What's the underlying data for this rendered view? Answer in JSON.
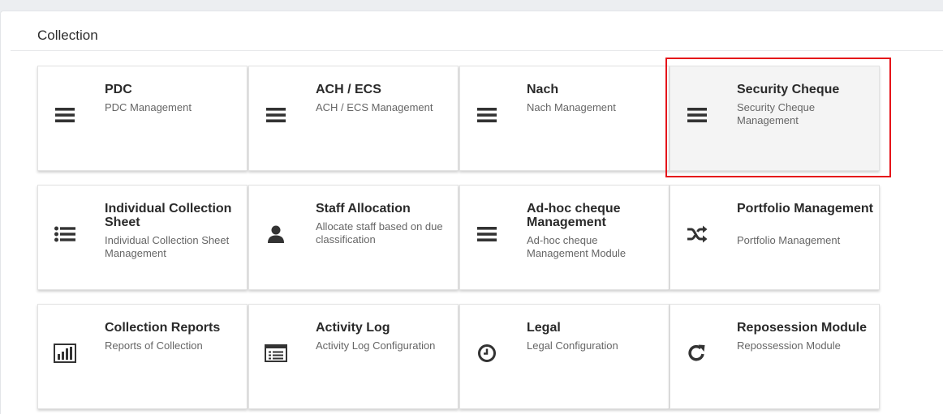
{
  "page": {
    "title": "Collection"
  },
  "cards": [
    {
      "title": "PDC",
      "description": "PDC Management",
      "icon": "bars-icon"
    },
    {
      "title": "ACH / ECS",
      "description": "ACH / ECS Management",
      "icon": "bars-icon"
    },
    {
      "title": "Nach",
      "description": "Nach Management",
      "icon": "bars-icon"
    },
    {
      "title": "Security Cheque",
      "description": "Security Cheque Management",
      "icon": "bars-icon"
    },
    {
      "title": "Individual Collection Sheet",
      "description": "Individual Collection Sheet Management",
      "icon": "list-icon"
    },
    {
      "title": "Staff Allocation",
      "description": "Allocate staff based on due classification",
      "icon": "user-icon"
    },
    {
      "title": "Ad-hoc cheque Management",
      "description": "Ad-hoc cheque Management Module",
      "icon": "bars-icon"
    },
    {
      "title": "Portfolio Management",
      "description": "Portfolio Management",
      "icon": "shuffle-icon"
    },
    {
      "title": "Collection Reports",
      "description": "Reports of Collection",
      "icon": "bar-chart-icon"
    },
    {
      "title": "Activity Log",
      "description": "Activity Log Configuration",
      "icon": "list-alt-icon"
    },
    {
      "title": "Legal",
      "description": "Legal Configuration",
      "icon": "clock-icon"
    },
    {
      "title": "Reposession Module",
      "description": "Repossession Module",
      "icon": "refresh-icon"
    }
  ],
  "colors": {
    "highlight": "#e5141a",
    "icon": "#333333",
    "active_card": "#f4f4f4"
  }
}
